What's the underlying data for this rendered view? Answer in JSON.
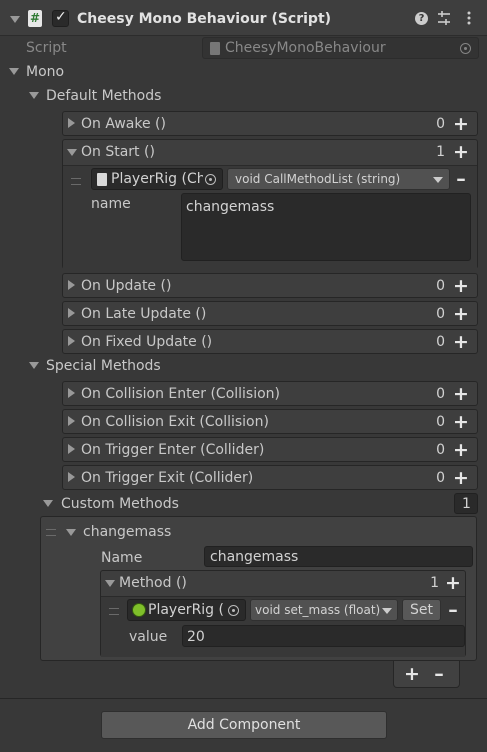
{
  "component": {
    "title": "Cheesy Mono Behaviour (Script)",
    "enabled_checkmark": "✓",
    "script_label": "Script",
    "script_value": "CheesyMonoBehaviour"
  },
  "mono": {
    "label": "Mono",
    "default_methods": {
      "label": "Default Methods",
      "on_awake": {
        "label": "On Awake ()",
        "count": "0"
      },
      "on_start": {
        "label": "On Start ()",
        "count": "1",
        "target": "PlayerRig (Ch",
        "function": "void CallMethodList (string)",
        "param_label": "name",
        "param_value": "changemass"
      },
      "on_update": {
        "label": "On Update ()",
        "count": "0"
      },
      "on_late_update": {
        "label": "On Late Update ()",
        "count": "0"
      },
      "on_fixed_update": {
        "label": "On Fixed Update ()",
        "count": "0"
      }
    },
    "special_methods": {
      "label": "Special Methods",
      "on_collision_enter": {
        "label": "On Collision Enter (Collision)",
        "count": "0"
      },
      "on_collision_exit": {
        "label": "On Collision Exit (Collision)",
        "count": "0"
      },
      "on_trigger_enter": {
        "label": "On Trigger Enter (Collider)",
        "count": "0"
      },
      "on_trigger_exit": {
        "label": "On Trigger Exit (Collider)",
        "count": "0"
      }
    },
    "custom_methods": {
      "label": "Custom Methods",
      "size": "1",
      "element": {
        "label": "changemass",
        "name_label": "Name",
        "name_value": "changemass",
        "method": {
          "label": "Method ()",
          "count": "1",
          "target": "PlayerRig (",
          "function": "void set_mass (float)",
          "set_button": "Set",
          "value_label": "value",
          "value": "20"
        }
      }
    }
  },
  "add_component_button": "Add Component",
  "colors": {
    "background": "#383838",
    "row_box": "#3e3e3e",
    "field": "#2a2a2a",
    "text": "#c8c8c8",
    "rigidbody_icon_green": "#7fbf2a"
  },
  "icons": [
    "foldout-arrow",
    "csharp-script-icon",
    "help-icon",
    "preset-icon",
    "kebab-menu-icon",
    "object-picker-icon",
    "rigidbody-icon",
    "plus-icon",
    "minus-icon",
    "drag-handle-icon",
    "dropdown-arrow-icon"
  ]
}
